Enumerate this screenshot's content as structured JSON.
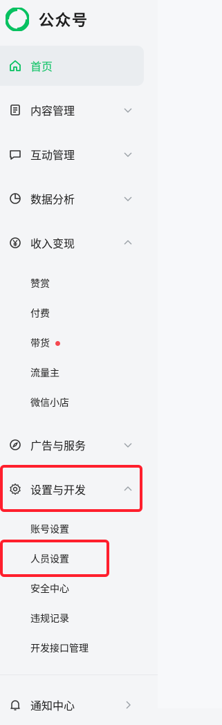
{
  "app": {
    "title": "公众号"
  },
  "colors": {
    "brand_green": "#07c160",
    "red_dot": "#f5484f",
    "highlight_red": "#ff1f2d"
  },
  "nav": {
    "home": {
      "label": "首页",
      "icon": "home-icon"
    },
    "content_mgmt": {
      "label": "内容管理",
      "icon": "document-icon"
    },
    "interaction_mgmt": {
      "label": "互动管理",
      "icon": "chat-bubble-icon"
    },
    "data_analysis": {
      "label": "数据分析",
      "icon": "pie-chart-icon"
    },
    "monetization": {
      "label": "收入变现",
      "icon": "yen-circle-icon",
      "items": [
        "赞赏",
        "付费",
        "带货",
        "流量主",
        "微信小店"
      ]
    },
    "ads_services": {
      "label": "广告与服务",
      "icon": "compass-icon"
    },
    "settings_dev": {
      "label": "设置与开发",
      "icon": "gear-icon",
      "items": [
        "账号设置",
        "人员设置",
        "安全中心",
        "违规记录",
        "开发接口管理"
      ]
    },
    "notifications": {
      "label": "通知中心",
      "icon": "bell-icon"
    }
  }
}
